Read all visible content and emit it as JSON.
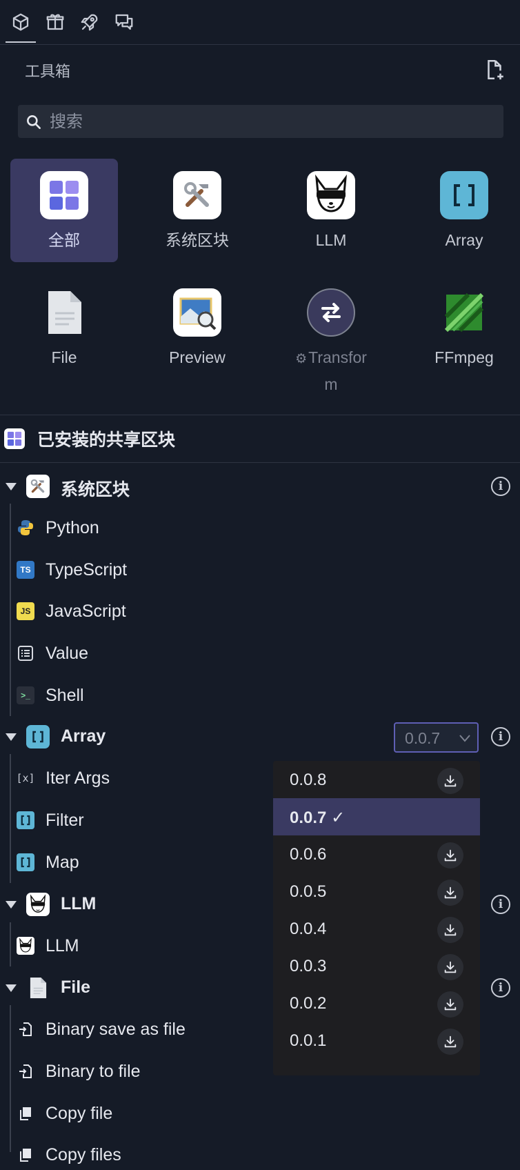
{
  "top_tabs": [
    {
      "icon": "cube-icon"
    },
    {
      "icon": "gift-icon"
    },
    {
      "icon": "rocket-icon"
    },
    {
      "icon": "chat-icon"
    }
  ],
  "toolbox": {
    "title": "工具箱",
    "new_icon": "file-plus-icon"
  },
  "search": {
    "placeholder": "搜索",
    "value": ""
  },
  "categories": [
    {
      "label": "全部",
      "icon": "grid-icon",
      "active": true
    },
    {
      "label": "系统区块",
      "icon": "tools-icon"
    },
    {
      "label": "LLM",
      "icon": "llm-mascot-icon"
    },
    {
      "label": "Array",
      "icon": "brackets-icon"
    },
    {
      "label": "File",
      "icon": "document-icon"
    },
    {
      "label": "Preview",
      "icon": "preview-icon"
    },
    {
      "label_line1": "Transfor",
      "label_line2": "m",
      "icon": "swap-icon",
      "disabled": true
    },
    {
      "label": "FFmpeg",
      "icon": "ffmpeg-logo-icon"
    }
  ],
  "installed": {
    "title": "已安装的共享区块"
  },
  "groups": {
    "system": {
      "title": "系统区块",
      "items": [
        {
          "label": "Python",
          "icon": "python-icon"
        },
        {
          "label": "TypeScript",
          "icon": "typescript-icon",
          "badge": "TS"
        },
        {
          "label": "JavaScript",
          "icon": "javascript-icon",
          "badge": "JS"
        },
        {
          "label": "Value",
          "icon": "value-icon"
        },
        {
          "label": "Shell",
          "icon": "shell-icon"
        }
      ]
    },
    "array": {
      "title": "Array",
      "version": "0.0.7",
      "items": [
        {
          "label": "Iter Args",
          "icon": "iter-args-icon",
          "badge": "x"
        },
        {
          "label": "Filter",
          "icon": "brackets-icon"
        },
        {
          "label": "Map",
          "icon": "brackets-icon"
        }
      ]
    },
    "llm": {
      "title": "LLM",
      "items": [
        {
          "label": "LLM",
          "icon": "llm-mascot-icon"
        }
      ]
    },
    "file": {
      "title": "File",
      "items": [
        {
          "label": "Binary save as file",
          "icon": "file-import-icon"
        },
        {
          "label": "Binary to file",
          "icon": "file-import-icon"
        },
        {
          "label": "Copy file",
          "icon": "copy-icon"
        },
        {
          "label": "Copy files",
          "icon": "copy-icon"
        }
      ]
    }
  },
  "version_dropdown": {
    "options": [
      {
        "label": "0.0.8"
      },
      {
        "label": "0.0.7",
        "selected": true,
        "check": "✓"
      },
      {
        "label": "0.0.6"
      },
      {
        "label": "0.0.5"
      },
      {
        "label": "0.0.4"
      },
      {
        "label": "0.0.3"
      },
      {
        "label": "0.0.2"
      },
      {
        "label": "0.0.1"
      }
    ]
  },
  "colors": {
    "background": "#151b27",
    "accent": "#3a3a62",
    "select_border": "#5f5fb5",
    "dropdown_bg": "#1e1e21"
  }
}
